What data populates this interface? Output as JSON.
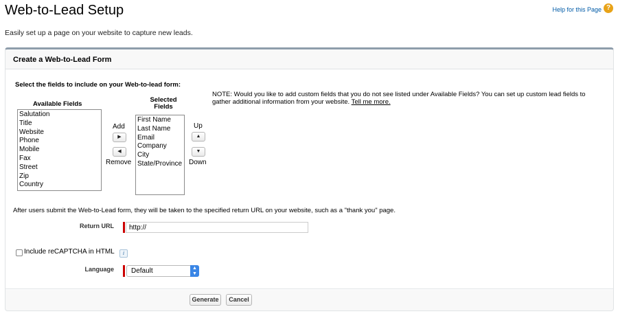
{
  "page": {
    "title": "Web-to-Lead Setup",
    "help_link": "Help for this Page",
    "help_icon_glyph": "?",
    "description": "Easily set up a page on your website to capture new leads."
  },
  "form": {
    "title": "Create a Web-to-Lead Form",
    "select_instruction": "Select the fields to include on your Web-to-lead form:",
    "available_heading": "Available Fields",
    "selected_heading_line1": "Selected",
    "selected_heading_line2": "Fields",
    "available_fields": [
      "Salutation",
      "Title",
      "Website",
      "Phone",
      "Mobile",
      "Fax",
      "Street",
      "Zip",
      "Country"
    ],
    "selected_fields": [
      "First Name",
      "Last Name",
      "Email",
      "Company",
      "City",
      "State/Province"
    ],
    "add_label": "Add",
    "remove_label": "Remove",
    "up_label": "Up",
    "down_label": "Down",
    "note_text": "NOTE: Would you like to add custom fields that you do not see listed under Available Fields? You can set up custom lead fields to gather additional information from your website.",
    "note_link": "Tell me more.",
    "return_info": "After users submit the Web-to-Lead form, they will be taken to the specified return URL on your website, such as a \"thank you\" page.",
    "return_url_label": "Return URL",
    "return_url_value": "http://",
    "recaptcha_label": "Include reCAPTCHA in HTML",
    "recaptcha_checked": false,
    "info_icon_glyph": "i",
    "language_label": "Language",
    "language_value": "Default",
    "generate_label": "Generate",
    "cancel_label": "Cancel"
  },
  "colors": {
    "required": "#c00000",
    "link": "#015ba7",
    "panel_border": "#8e9dab",
    "select_accent": "#3a86e6",
    "help_icon": "#e8a318"
  },
  "icons": {
    "help": "help-icon",
    "add": "triangle-right-icon",
    "remove": "triangle-left-icon",
    "up": "triangle-up-icon",
    "down": "triangle-down-icon",
    "info": "info-icon",
    "select": "chevron-updown-icon"
  }
}
